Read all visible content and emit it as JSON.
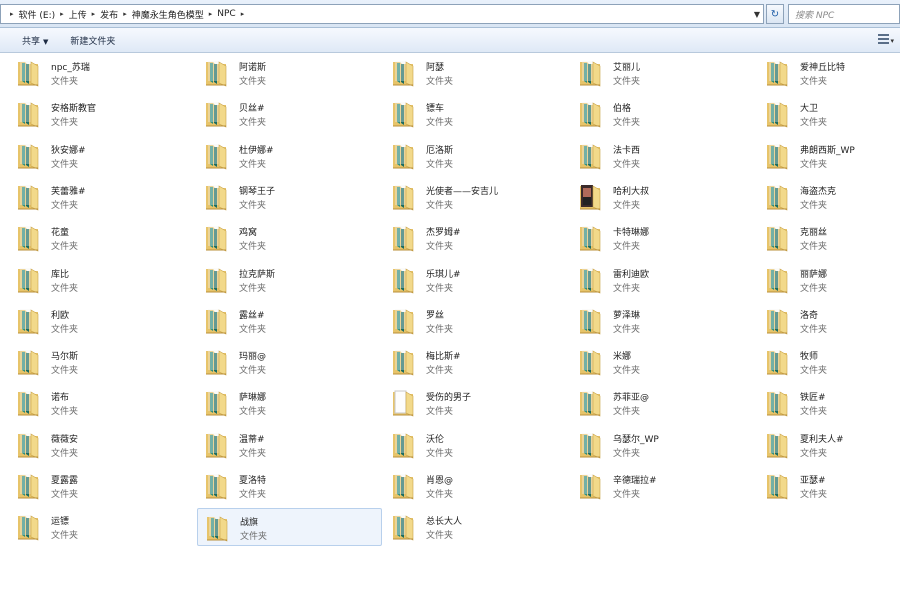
{
  "address": {
    "breadcrumbs": [
      "软件 (E:)",
      "上传",
      "发布",
      "神魔永生角色模型",
      "NPC"
    ]
  },
  "search": {
    "placeholder": "搜索 NPC"
  },
  "toolbar": {
    "share_label": "共享",
    "new_folder_label": "新建文件夹"
  },
  "folder_type_label": "文件夹",
  "items": [
    {
      "name": "npc_苏瑞"
    },
    {
      "name": "阿诺斯"
    },
    {
      "name": "阿瑟"
    },
    {
      "name": "艾丽儿"
    },
    {
      "name": "爱神丘比特"
    },
    {
      "name": "安格斯教官"
    },
    {
      "name": "贝丝#"
    },
    {
      "name": "镖车"
    },
    {
      "name": "伯格"
    },
    {
      "name": "大卫"
    },
    {
      "name": "狄安娜#"
    },
    {
      "name": "杜伊娜#"
    },
    {
      "name": "厄洛斯"
    },
    {
      "name": "法卡西"
    },
    {
      "name": "弗朗西斯_WP"
    },
    {
      "name": "芙蕾雅#"
    },
    {
      "name": "钢琴王子"
    },
    {
      "name": "光使者——安吉儿"
    },
    {
      "name": "哈利大叔",
      "thumb": "portrait"
    },
    {
      "name": "海盗杰克"
    },
    {
      "name": "花童"
    },
    {
      "name": "鸡窝"
    },
    {
      "name": "杰罗姆#"
    },
    {
      "name": "卡特琳娜"
    },
    {
      "name": "克丽丝"
    },
    {
      "name": "库比"
    },
    {
      "name": "拉克萨斯"
    },
    {
      "name": "乐琪儿#"
    },
    {
      "name": "雷利迪欧"
    },
    {
      "name": "丽萨娜"
    },
    {
      "name": "利欧"
    },
    {
      "name": "露丝#"
    },
    {
      "name": "罗丝"
    },
    {
      "name": "萝泽琳"
    },
    {
      "name": "洛奇"
    },
    {
      "name": "马尔斯"
    },
    {
      "name": "玛丽@"
    },
    {
      "name": "梅比斯#"
    },
    {
      "name": "米娜"
    },
    {
      "name": "牧师"
    },
    {
      "name": "诺布"
    },
    {
      "name": "萨琳娜"
    },
    {
      "name": "受伤的男子",
      "thumb": "document"
    },
    {
      "name": "苏菲亚@"
    },
    {
      "name": "铁匠#"
    },
    {
      "name": "薇薇安"
    },
    {
      "name": "温蒂#"
    },
    {
      "name": "沃伦"
    },
    {
      "name": "乌瑟尔_WP"
    },
    {
      "name": "夏利夫人#"
    },
    {
      "name": "夏露露"
    },
    {
      "name": "夏洛特"
    },
    {
      "name": "肖恩@"
    },
    {
      "name": "辛德瑞拉#"
    },
    {
      "name": "亚瑟#"
    },
    {
      "name": "运镖"
    },
    {
      "name": "战旗",
      "selected": true
    },
    {
      "name": "总长大人"
    }
  ]
}
